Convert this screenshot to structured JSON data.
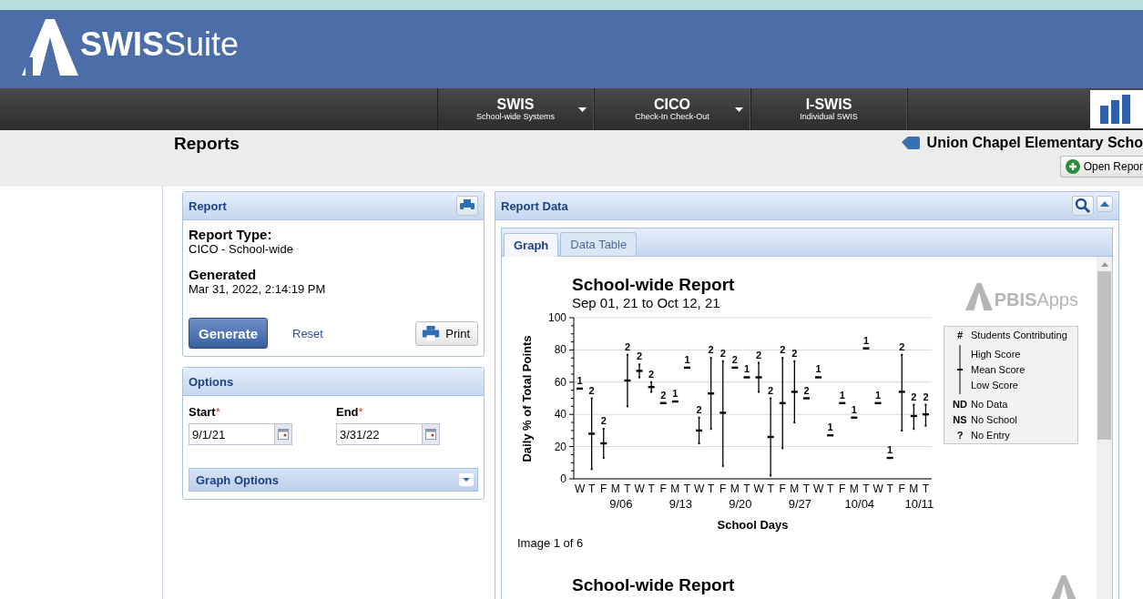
{
  "header": {
    "logo_bold": "SWIS",
    "logo_light": "Suite"
  },
  "nav": [
    {
      "title": "SWIS",
      "subtitle": "School-wide Systems",
      "dropdown": true
    },
    {
      "title": "CICO",
      "subtitle": "Check-In Check-Out",
      "dropdown": true
    },
    {
      "title": "I-SWIS",
      "subtitle": "Individual SWIS",
      "dropdown": false
    }
  ],
  "page": {
    "title": "Reports",
    "school": "Union Chapel Elementary Scho",
    "open_button": "Open Repor"
  },
  "report_panel": {
    "title": "Report",
    "fields": [
      {
        "label": "Report Type:",
        "value": "CICO - School-wide"
      },
      {
        "label": "Generated",
        "value": "Mar 31, 2022, 2:14:19 PM"
      }
    ],
    "generate": "Generate",
    "reset": "Reset",
    "print": "Print"
  },
  "options_panel": {
    "title": "Options",
    "dates": [
      {
        "label": "Start",
        "required_mark": "*",
        "value": "9/1/21"
      },
      {
        "label": "End",
        "required_mark": "*",
        "value": "3/31/22"
      }
    ],
    "graph_options": "Graph Options"
  },
  "report_data": {
    "title": "Report Data",
    "tabs": [
      {
        "label": "Graph",
        "selected": true
      },
      {
        "label": "Data Table",
        "selected": false
      }
    ],
    "graph": {
      "title": "School-wide Report",
      "subtitle": "Sep 01, 21 to Oct 12, 21",
      "logo_bold": "PBIS",
      "logo_light": "Apps",
      "chart_data": {
        "type": "scatter",
        "xlabel": "School Days",
        "ylabel": "Daily % of Total Points",
        "categories": [
          "W",
          "T",
          "F",
          "M",
          "T",
          "W",
          "T",
          "F",
          "M",
          "T",
          "W",
          "T",
          "F",
          "M",
          "T",
          "W",
          "T",
          "F",
          "M",
          "T",
          "W",
          "T",
          "F",
          "M",
          "T",
          "W",
          "T",
          "F",
          "M",
          "T"
        ],
        "grid": true,
        "ylim": [
          0,
          100
        ],
        "yticks": [
          0,
          20,
          40,
          60,
          80,
          100
        ],
        "series": [
          {
            "name": "Mean Score",
            "color": "#000000",
            "values": [
              56,
              28,
              22,
              null,
              61,
              67,
              57,
              47,
              48,
              69,
              30,
              53,
              41,
              69,
              63,
              63,
              26,
              47,
              54,
              50,
              63,
              27,
              47,
              38,
              81,
              47,
              13,
              54,
              39,
              40
            ]
          },
          {
            "name": "High Score",
            "color": "#000000",
            "values": [
              null,
              50,
              31,
              null,
              77,
              71,
              60,
              null,
              null,
              null,
              38,
              75,
              73,
              null,
              null,
              72,
              50,
              75,
              73,
              null,
              null,
              null,
              null,
              null,
              null,
              null,
              null,
              77,
              46,
              46
            ]
          },
          {
            "name": "Low Score",
            "color": "#000000",
            "values": [
              null,
              6,
              13,
              null,
              45,
              63,
              54,
              null,
              null,
              null,
              22,
              31,
              8,
              null,
              null,
              54,
              2,
              19,
              35,
              null,
              null,
              null,
              null,
              null,
              null,
              null,
              null,
              30,
              31,
              33
            ]
          }
        ],
        "value_labels": [
          "1",
          "2",
          "2",
          null,
          "2",
          "2",
          "2",
          "2",
          "1",
          "1",
          "2",
          "2",
          "2",
          "2",
          "1",
          "2",
          "2",
          "2",
          "2",
          "2",
          "1",
          "1",
          "1",
          "1",
          "1",
          "1",
          "1",
          "2",
          "2",
          "2"
        ]
      },
      "legend": [
        {
          "kind": "symbol",
          "symbol": "#",
          "label": "Students Contributing"
        },
        {
          "kind": "range"
        },
        {
          "kind": "symbol",
          "symbol": "ND",
          "label": "No Data"
        },
        {
          "kind": "symbol",
          "symbol": "NS",
          "label": "No School"
        },
        {
          "kind": "symbol",
          "symbol": "?",
          "label": "No Entry"
        }
      ],
      "week_labels": [
        "9/06",
        "9/13",
        "9/20",
        "9/27",
        "10/04",
        "10/11"
      ],
      "caption": "Image 1 of 6"
    },
    "next_graph": {
      "title": "School-wide Report"
    }
  }
}
